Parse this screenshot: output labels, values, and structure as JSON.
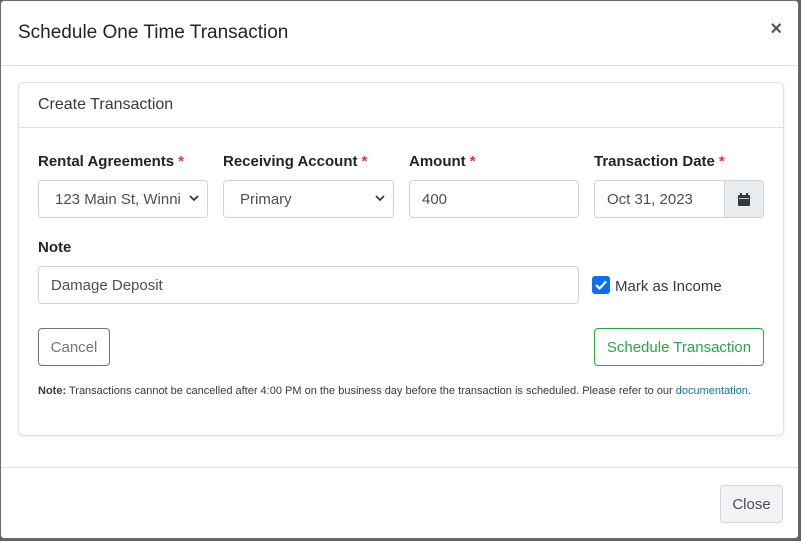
{
  "modal": {
    "title": "Schedule One Time Transaction",
    "close_symbol": "×"
  },
  "card": {
    "title": "Create Transaction"
  },
  "form": {
    "required_marker": "*",
    "rental_agreements": {
      "label": "Rental Agreements",
      "value": "123 Main St, Winni"
    },
    "receiving_account": {
      "label": "Receiving Account",
      "value": "Primary"
    },
    "amount": {
      "label": "Amount",
      "value": "400"
    },
    "transaction_date": {
      "label": "Transaction Date",
      "value": "Oct 31, 2023",
      "icon": "calendar-icon"
    },
    "note": {
      "label": "Note",
      "value": "Damage Deposit"
    },
    "mark_as_income": {
      "label": "Mark as Income",
      "checked": true
    }
  },
  "buttons": {
    "cancel": "Cancel",
    "schedule": "Schedule Transaction",
    "close": "Close"
  },
  "note_text": {
    "prefix": "Note:",
    "body": "Transactions cannot be cancelled after 4:00 PM on the business day before the transaction is scheduled. Please refer to our",
    "link": "documentation",
    "suffix": "."
  },
  "colors": {
    "primary": "#0d6efd",
    "success": "#28a745",
    "required": "#dc3545",
    "link": "#17719a"
  }
}
